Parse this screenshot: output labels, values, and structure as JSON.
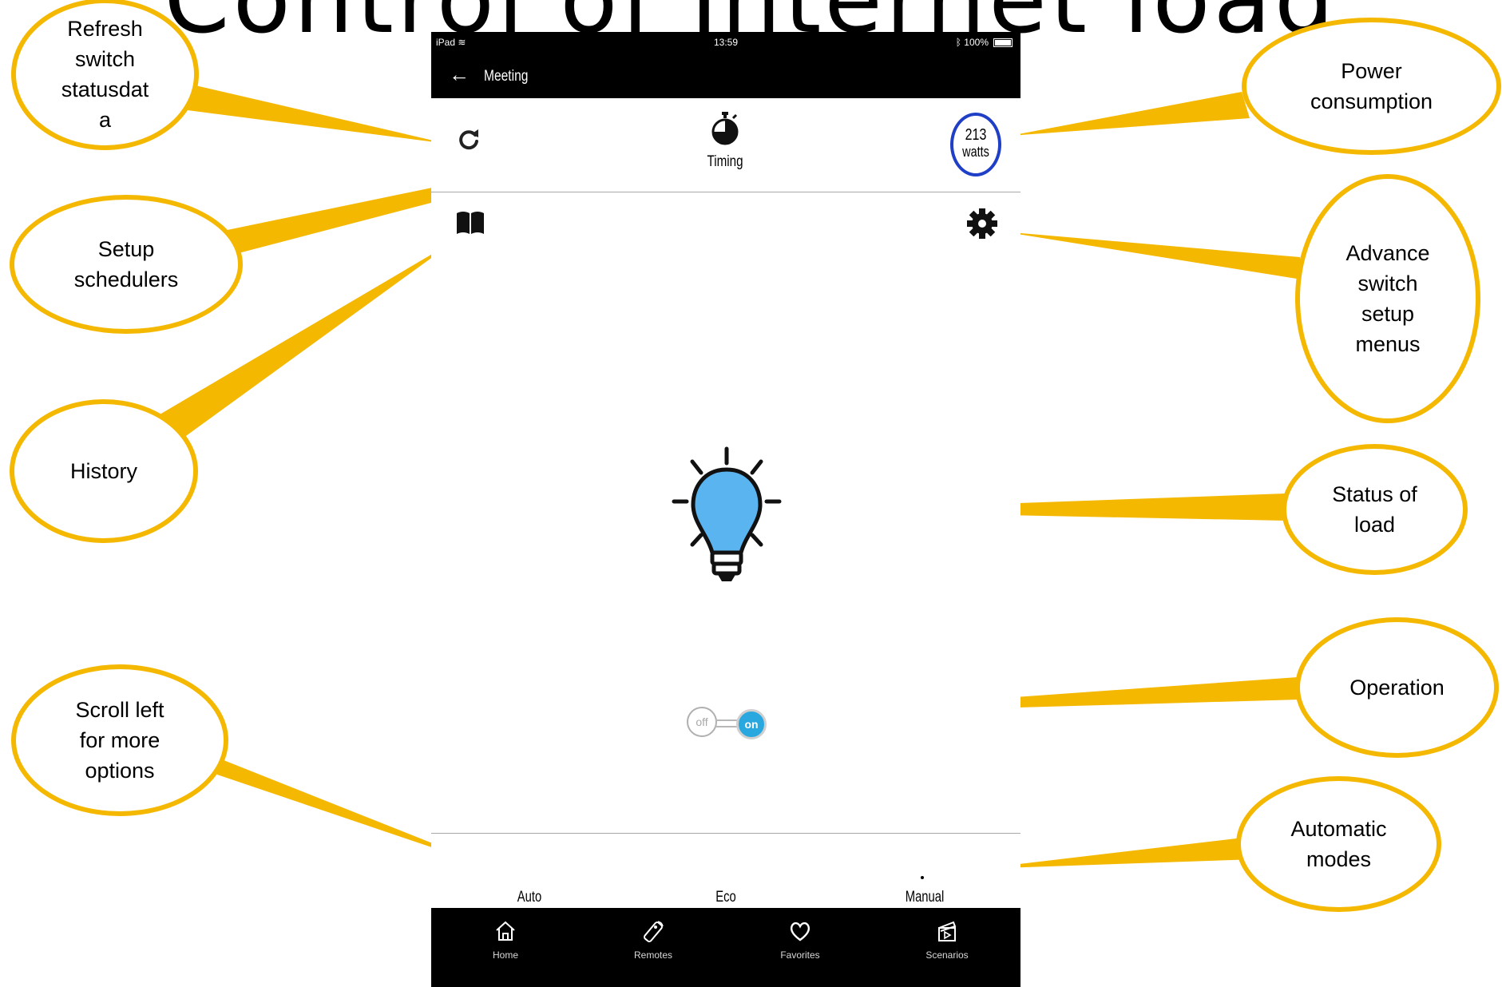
{
  "page_title": "Control of Internet load",
  "status_bar": {
    "carrier": "iPad",
    "time": "13:59",
    "battery": "100%"
  },
  "nav": {
    "back_label": "←",
    "title": "Meeting"
  },
  "toolbar": {
    "timing_label": "Timing",
    "power_value": "213",
    "power_unit": "watts"
  },
  "switch": {
    "off_label": "off",
    "on_label": "on",
    "state": "on"
  },
  "modes": [
    {
      "label": "Auto",
      "color": "#2e9b3a"
    },
    {
      "label": "Eco",
      "color": "#f0962c"
    },
    {
      "label": "Manual",
      "color": "#9c9c9c"
    }
  ],
  "tabbar": {
    "items": [
      {
        "label": "Home",
        "icon": "home-icon"
      },
      {
        "label": "Remotes",
        "icon": "remote-icon"
      },
      {
        "label": "Favorites",
        "icon": "heart-icon"
      },
      {
        "label": "Scenarios",
        "icon": "clapperboard-icon"
      }
    ]
  },
  "colors": {
    "callout_border": "#f5b800",
    "bulb_fill": "#5ab4f0",
    "power_ring": "#1f3fc6",
    "switch_on": "#29a8e0"
  },
  "annotations": {
    "refresh": "Refresh\nswitch\nstatusdat\na",
    "power": "Power\nconsumption",
    "schedulers": "Setup\nschedulers",
    "advance": "Advance\nswitch\nsetup\nmenus",
    "history": "History",
    "status": "Status of\nload",
    "operation": "Operation",
    "scroll": "Scroll left\nfor more\noptions",
    "automatic": "Automatic\nmodes"
  }
}
